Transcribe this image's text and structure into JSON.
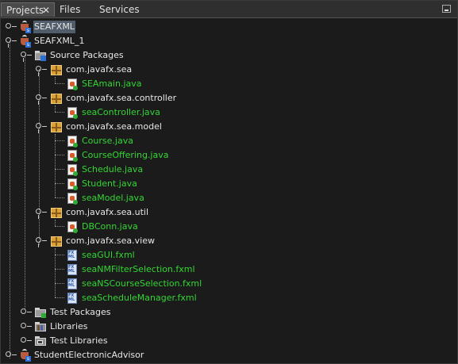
{
  "tabs": [
    {
      "label": "Projects",
      "active": true,
      "close": "✕"
    },
    {
      "label": "Files",
      "active": false
    },
    {
      "label": "Services",
      "active": false
    }
  ],
  "icons": {
    "minimize": "minimize-window-icon",
    "project": "java-project-icon",
    "folder": "source-folder-icon",
    "package": "package-icon",
    "java": "java-file-icon",
    "fxml": "fxml-file-icon",
    "libraries": "libraries-icon",
    "test_libraries": "test-libraries-icon"
  },
  "colors": {
    "background": "#1b1b1b",
    "file_text": "#33d633",
    "text": "#e6e6e6",
    "selection": "#515d6b"
  },
  "tree": {
    "seafxml": "SEAFXML",
    "seafxml_1": "SEAFXML_1",
    "source_packages": "Source Packages",
    "pkg_sea": "com.javafx.sea",
    "seamain": "SEAmain.java",
    "pkg_controller": "com.javafx.sea.controller",
    "seacontroller": "seaController.java",
    "pkg_model": "com.javafx.sea.model",
    "course": "Course.java",
    "courseoffering": "CourseOffering.java",
    "schedule": "Schedule.java",
    "student": "Student.java",
    "seamodel": "seaModel.java",
    "pkg_util": "com.javafx.sea.util",
    "dbconn": "DBConn.java",
    "pkg_view": "com.javafx.sea.view",
    "seagui": "seaGUI.fxml",
    "seanmfilter": "seaNMFilterSelection.fxml",
    "seanscourse": "seaNSCourseSelection.fxml",
    "seaschedule": "seaScheduleManager.fxml",
    "test_packages": "Test Packages",
    "libraries": "Libraries",
    "test_libraries": "Test Libraries",
    "student_advisor": "StudentElectronicAdvisor"
  }
}
